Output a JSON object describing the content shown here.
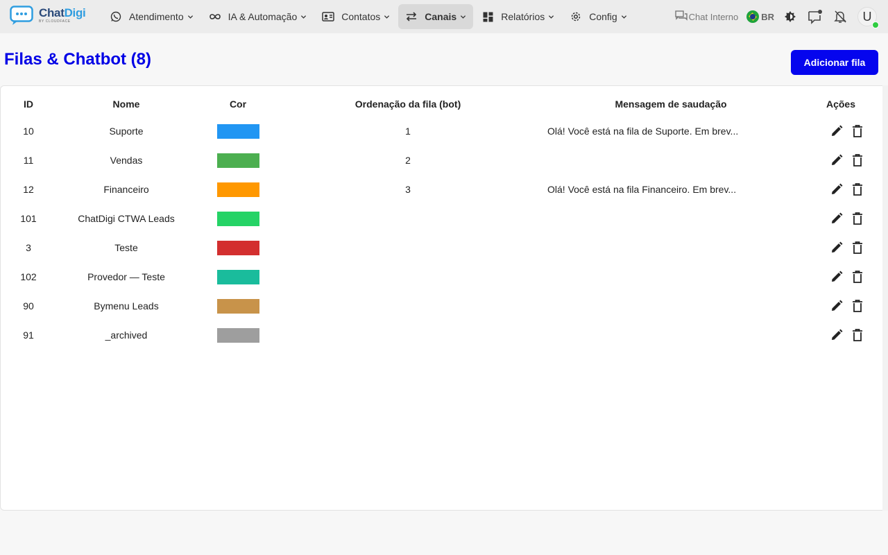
{
  "brand": {
    "name_part1": "Chat",
    "name_part2": "Digi",
    "tagline": "BY CLOUDFACE",
    "logo_icon": "chat-bubble-dots-icon"
  },
  "nav": [
    {
      "label": "Atendimento",
      "icon": "whatsapp-icon"
    },
    {
      "label": "IA & Automação",
      "icon": "infinity-icon"
    },
    {
      "label": "Contatos",
      "icon": "contact-card-icon"
    },
    {
      "label": "Canais",
      "icon": "swap-arrows-icon",
      "active": true
    },
    {
      "label": "Relatórios",
      "icon": "dashboard-icon"
    },
    {
      "label": "Config",
      "icon": "gear-icon"
    }
  ],
  "right": {
    "chat_interno": "Chat Interno",
    "lang": "BR",
    "avatar_initial": "U"
  },
  "page": {
    "title": "Filas & Chatbot (8)",
    "add_button": "Adicionar fila"
  },
  "table": {
    "headers": {
      "id": "ID",
      "nome": "Nome",
      "cor": "Cor",
      "ordenacao": "Ordenação da fila (bot)",
      "mensagem": "Mensagem de saudação",
      "acoes": "Ações"
    },
    "rows": [
      {
        "id": "10",
        "nome": "Suporte",
        "cor": "#2196f3",
        "ordenacao": "1",
        "mensagem": "Olá! Você está na fila de Suporte. Em brev..."
      },
      {
        "id": "11",
        "nome": "Vendas",
        "cor": "#4caf50",
        "ordenacao": "2",
        "mensagem": ""
      },
      {
        "id": "12",
        "nome": "Financeiro",
        "cor": "#ff9800",
        "ordenacao": "3",
        "mensagem": "Olá! Você está na fila Financeiro. Em brev..."
      },
      {
        "id": "101",
        "nome": "ChatDigi CTWA Leads",
        "cor": "#25d366",
        "ordenacao": "",
        "mensagem": ""
      },
      {
        "id": "3",
        "nome": "Teste",
        "cor": "#d32f2f",
        "ordenacao": "",
        "mensagem": ""
      },
      {
        "id": "102",
        "nome": "Provedor — Teste",
        "cor": "#1abc9c",
        "ordenacao": "",
        "mensagem": ""
      },
      {
        "id": "90",
        "nome": "Bymenu Leads",
        "cor": "#c8934a",
        "ordenacao": "",
        "mensagem": ""
      },
      {
        "id": "91",
        "nome": "_archived",
        "cor": "#9e9e9e",
        "ordenacao": "",
        "mensagem": ""
      }
    ]
  }
}
